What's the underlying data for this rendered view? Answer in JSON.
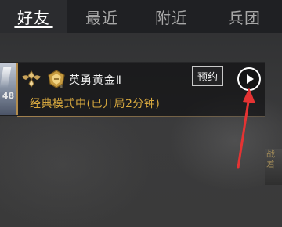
{
  "tabs": [
    {
      "label": "好友",
      "active": true
    },
    {
      "label": "最近",
      "active": false
    },
    {
      "label": "附近",
      "active": false
    },
    {
      "label": "兵团",
      "active": false
    }
  ],
  "friend_card": {
    "avatar_level": "48",
    "rank_title": "英勇黄金Ⅱ",
    "status": "经典模式中(已开局2分钟)",
    "reserve_label": "预约",
    "status_color": "#d8a93f"
  },
  "side_strip_text": "战着",
  "colors": {
    "accent_gold": "#b28c4d",
    "arrow": "#e53333",
    "tab_active": "#ffffff"
  }
}
